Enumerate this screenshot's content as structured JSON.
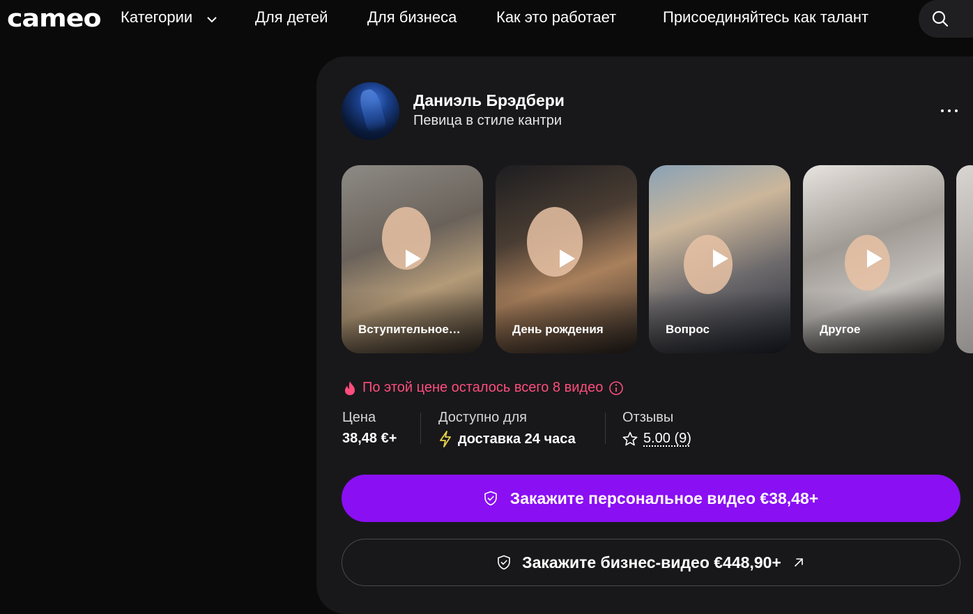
{
  "nav": {
    "logo": "cameo",
    "categories": "Категории",
    "kids": "Для детей",
    "business": "Для бизнеса",
    "how": "Как это работает",
    "join": "Присоединяйтесь как талант"
  },
  "talent": {
    "name": "Даниэль Брэдбери",
    "role": "Певица в стиле кантри"
  },
  "videos": [
    {
      "label": "Вступительное…"
    },
    {
      "label": "День рождения"
    },
    {
      "label": "Вопрос"
    },
    {
      "label": "Другое"
    }
  ],
  "scarcity": "По этой цене осталось всего 8 видео",
  "stats": {
    "price_label": "Цена",
    "price_value": "38,48 €+",
    "availability_label": "Доступно для",
    "availability_value": "доставка 24 часа",
    "reviews_label": "Отзывы",
    "reviews_value": "5.00 (9)"
  },
  "cta": {
    "personal": "Закажите персональное видео €38,48+",
    "business": "Закажите бизнес-видео €448,90+"
  },
  "colors": {
    "accent": "#8a0ff3",
    "scarcity": "#ff4d7d",
    "lightning": "#e9d44b"
  }
}
